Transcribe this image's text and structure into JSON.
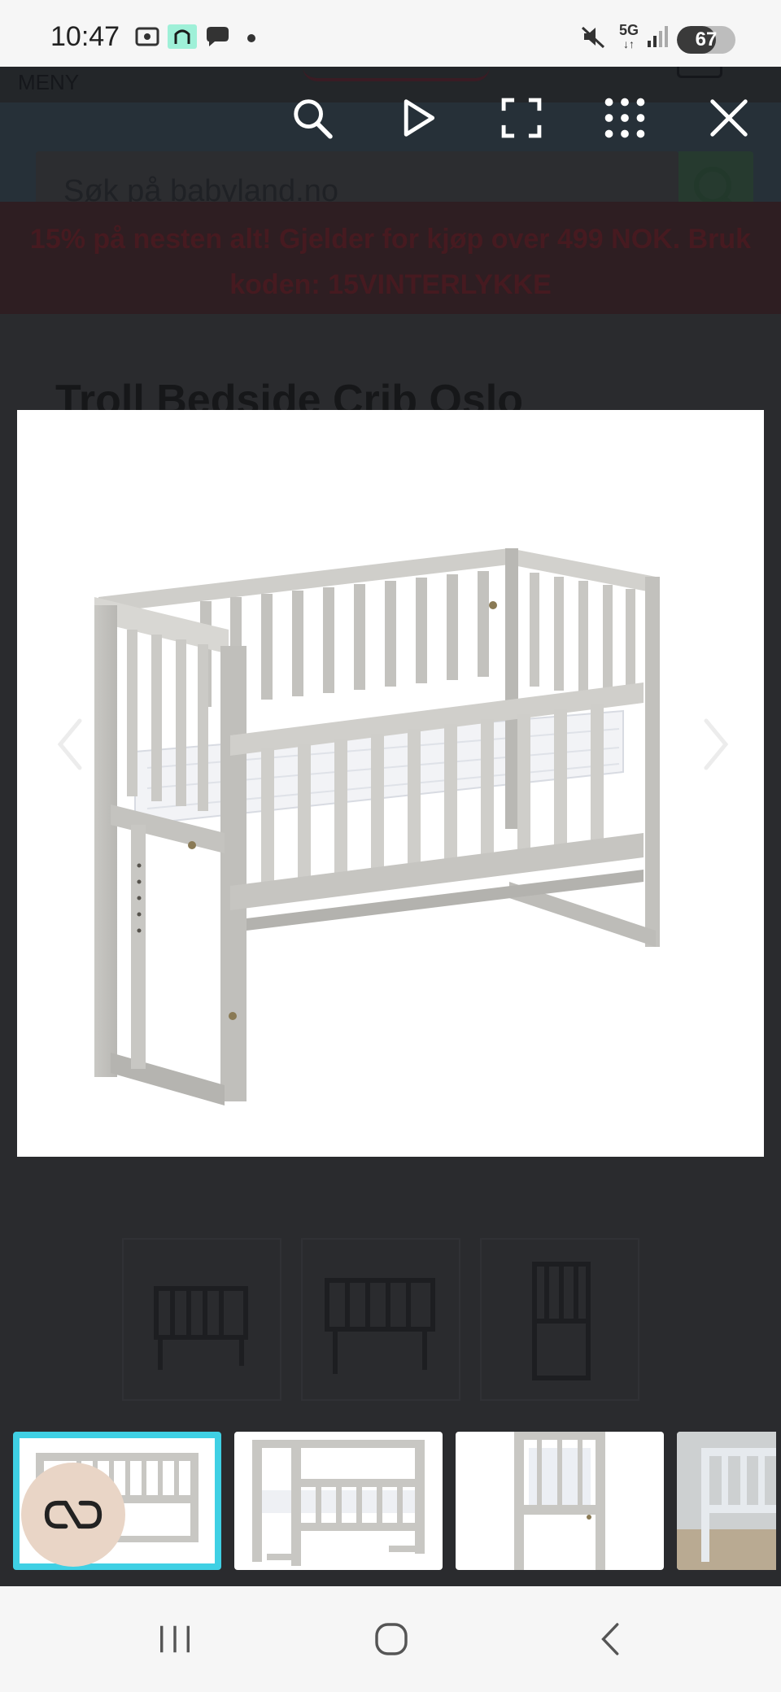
{
  "status_bar": {
    "time": "10:47",
    "network": "5G",
    "battery": "67",
    "battery_level": 0.67
  },
  "page": {
    "menu_label": "MENY",
    "search_placeholder": "Søk på babyland.no",
    "promo_line1": "15% på nesten alt! Gjelder for kjøp over 499 NOK. Bruk",
    "promo_line2": "koden: 15VINTERLYKKE",
    "product_title": "Troll Bedside Crib Oslo"
  },
  "viewer": {
    "tools": [
      "search-icon",
      "play-icon",
      "fullscreen-icon",
      "apps-grid-icon",
      "close-icon"
    ],
    "thumbnails_count": 4,
    "selected_thumbnail": 1
  },
  "colors": {
    "selection": "#3fd0e4",
    "crib": "#c8c7c3",
    "ai_button": "#e9d5c6"
  }
}
